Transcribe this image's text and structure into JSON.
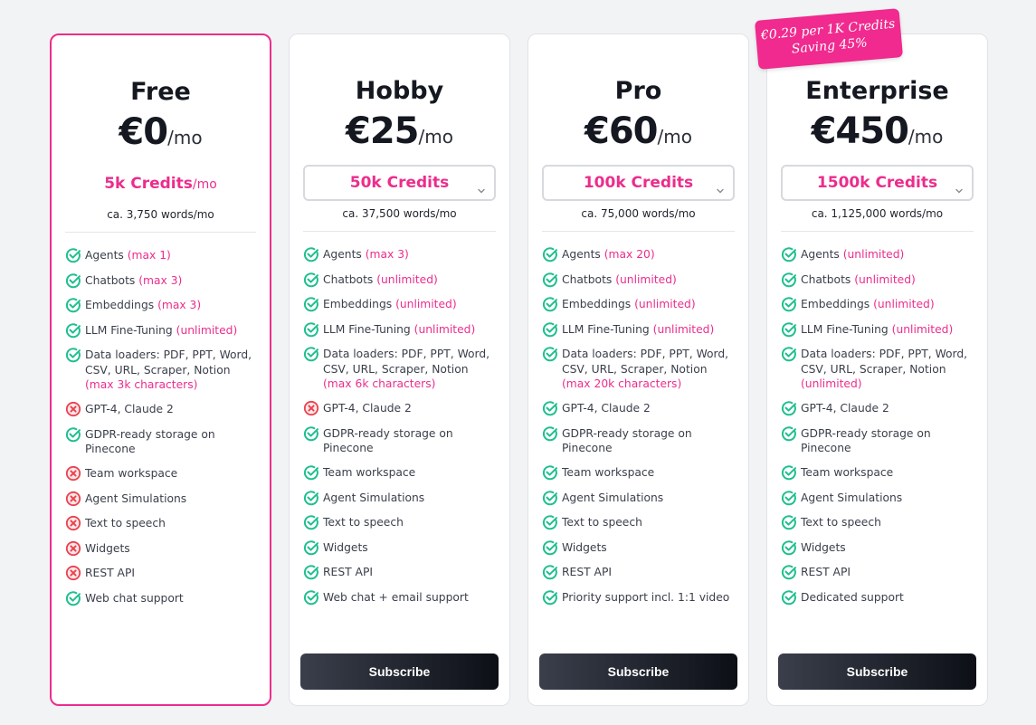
{
  "badge": {
    "line1": "€0.29 per 1K Credits",
    "line2": "Saving 45%"
  },
  "colors": {
    "accent": "#ec2d8c",
    "check": "#1fbf8f",
    "cross": "#e8424e"
  },
  "icons": {
    "included": "check-circle-icon",
    "excluded": "x-circle-icon",
    "dropdown": "chevron-down-icon"
  },
  "plans": [
    {
      "name": "Free",
      "price": "€0",
      "per": "/mo",
      "credits": "5k Credits",
      "credits_suffix": "/mo",
      "credits_dropdown": false,
      "words": "ca. 3,750 words/mo",
      "subscribe": null,
      "features": [
        {
          "text": "Agents ",
          "note": "(max 1)",
          "included": true
        },
        {
          "text": "Chatbots ",
          "note": "(max 3)",
          "included": true
        },
        {
          "text": "Embeddings ",
          "note": "(max 3)",
          "included": true
        },
        {
          "text": "LLM Fine-Tuning ",
          "note": "(unlimited)",
          "included": true
        },
        {
          "text": "Data loaders: PDF, PPT, Word, CSV, URL, Scraper, Notion ",
          "note": "(max 3k characters)",
          "included": true
        },
        {
          "text": "GPT-4, Claude 2",
          "note": "",
          "included": false
        },
        {
          "text": "GDPR-ready storage on Pinecone",
          "note": "",
          "included": true
        },
        {
          "text": "Team workspace",
          "note": "",
          "included": false
        },
        {
          "text": "Agent Simulations",
          "note": "",
          "included": false
        },
        {
          "text": "Text to speech",
          "note": "",
          "included": false
        },
        {
          "text": "Widgets",
          "note": "",
          "included": false
        },
        {
          "text": "REST API",
          "note": "",
          "included": false
        },
        {
          "text": "Web chat support",
          "note": "",
          "included": true
        }
      ]
    },
    {
      "name": "Hobby",
      "price": "€25",
      "per": "/mo",
      "credits": "50k Credits",
      "credits_suffix": "",
      "credits_dropdown": true,
      "words": "ca. 37,500 words/mo",
      "subscribe": "Subscribe",
      "features": [
        {
          "text": "Agents ",
          "note": "(max 3)",
          "included": true
        },
        {
          "text": "Chatbots ",
          "note": "(unlimited)",
          "included": true
        },
        {
          "text": "Embeddings ",
          "note": "(unlimited)",
          "included": true
        },
        {
          "text": "LLM Fine-Tuning ",
          "note": "(unlimited)",
          "included": true
        },
        {
          "text": "Data loaders: PDF, PPT, Word, CSV, URL, Scraper, Notion ",
          "note": "(max 6k characters)",
          "included": true
        },
        {
          "text": "GPT-4, Claude 2",
          "note": "",
          "included": false
        },
        {
          "text": "GDPR-ready storage on Pinecone",
          "note": "",
          "included": true
        },
        {
          "text": "Team workspace",
          "note": "",
          "included": true
        },
        {
          "text": "Agent Simulations",
          "note": "",
          "included": true
        },
        {
          "text": "Text to speech",
          "note": "",
          "included": true
        },
        {
          "text": "Widgets",
          "note": "",
          "included": true
        },
        {
          "text": "REST API",
          "note": "",
          "included": true
        },
        {
          "text": "Web chat + email support",
          "note": "",
          "included": true
        }
      ]
    },
    {
      "name": "Pro",
      "price": "€60",
      "per": "/mo",
      "credits": "100k Credits",
      "credits_suffix": "",
      "credits_dropdown": true,
      "words": "ca. 75,000 words/mo",
      "subscribe": "Subscribe",
      "features": [
        {
          "text": "Agents ",
          "note": "(max 20)",
          "included": true
        },
        {
          "text": "Chatbots ",
          "note": "(unlimited)",
          "included": true
        },
        {
          "text": "Embeddings ",
          "note": "(unlimited)",
          "included": true
        },
        {
          "text": "LLM Fine-Tuning ",
          "note": "(unlimited)",
          "included": true
        },
        {
          "text": "Data loaders: PDF, PPT, Word, CSV, URL, Scraper, Notion ",
          "note": "(max 20k characters)",
          "included": true
        },
        {
          "text": "GPT-4, Claude 2",
          "note": "",
          "included": true
        },
        {
          "text": "GDPR-ready storage on Pinecone",
          "note": "",
          "included": true
        },
        {
          "text": "Team workspace",
          "note": "",
          "included": true
        },
        {
          "text": "Agent Simulations",
          "note": "",
          "included": true
        },
        {
          "text": "Text to speech",
          "note": "",
          "included": true
        },
        {
          "text": "Widgets",
          "note": "",
          "included": true
        },
        {
          "text": "REST API",
          "note": "",
          "included": true
        },
        {
          "text": "Priority support incl. 1:1 video",
          "note": "",
          "included": true
        }
      ]
    },
    {
      "name": "Enterprise",
      "price": "€450",
      "per": "/mo",
      "credits": "1500k Credits",
      "credits_suffix": "",
      "credits_dropdown": true,
      "words": "ca. 1,125,000 words/mo",
      "subscribe": "Subscribe",
      "features": [
        {
          "text": "Agents ",
          "note": "(unlimited)",
          "included": true
        },
        {
          "text": "Chatbots ",
          "note": "(unlimited)",
          "included": true
        },
        {
          "text": "Embeddings ",
          "note": "(unlimited)",
          "included": true
        },
        {
          "text": "LLM Fine-Tuning ",
          "note": "(unlimited)",
          "included": true
        },
        {
          "text": "Data loaders: PDF, PPT, Word, CSV, URL, Scraper, Notion ",
          "note": "(unlimited)",
          "included": true
        },
        {
          "text": "GPT-4, Claude 2",
          "note": "",
          "included": true
        },
        {
          "text": "GDPR-ready storage on Pinecone",
          "note": "",
          "included": true
        },
        {
          "text": "Team workspace",
          "note": "",
          "included": true
        },
        {
          "text": "Agent Simulations",
          "note": "",
          "included": true
        },
        {
          "text": "Text to speech",
          "note": "",
          "included": true
        },
        {
          "text": "Widgets",
          "note": "",
          "included": true
        },
        {
          "text": "REST API",
          "note": "",
          "included": true
        },
        {
          "text": "Dedicated support",
          "note": "",
          "included": true
        }
      ]
    }
  ]
}
